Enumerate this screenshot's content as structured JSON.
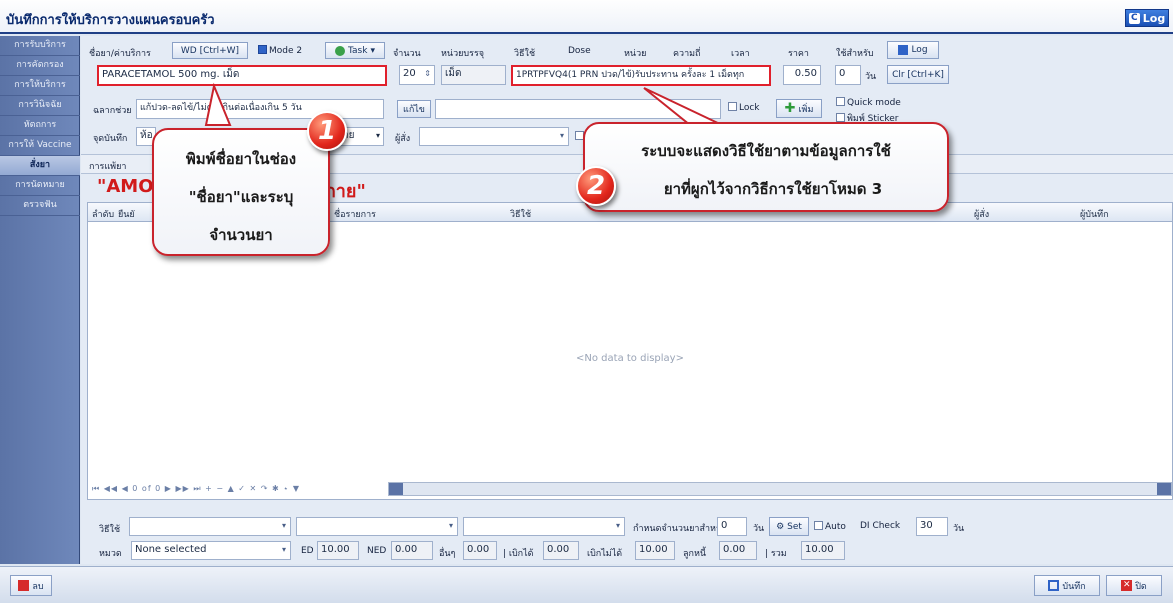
{
  "window": {
    "title": "บันทึกการให้บริการวางแผนครอบครัว",
    "log_label": "Log"
  },
  "sidebar": {
    "items": [
      {
        "label": "การรับบริการ"
      },
      {
        "label": "การคัดกรอง"
      },
      {
        "label": "การให้บริการ"
      },
      {
        "label": "การวินิจฉัย"
      },
      {
        "label": "หัตถการ"
      },
      {
        "label": "การให้ Vaccine"
      },
      {
        "label": "สั่งยา",
        "active": true
      },
      {
        "label": "การนัดหมาย"
      },
      {
        "label": "ตรวจฟัน"
      }
    ]
  },
  "header_row": {
    "drug_label": "ชื่อยา/ค่าบริการ",
    "wd_button": "WD [Ctrl+W]",
    "mode2_label": "Mode 2",
    "task_button": "Task",
    "qty_label": "จำนวน",
    "unit_label": "หน่วยบรรจุ",
    "usage_label": "วิธีใช้",
    "dose_label": "Dose",
    "dose_unit_label": "หน่วย",
    "freq_label": "ความถี่",
    "time_label": "เวลา",
    "price_label": "ราคา",
    "use_for_label": "ใช้สำหรับ",
    "log_button": "Log"
  },
  "entry_row": {
    "drug_name": "PARACETAMOL 500 mg. เม็ด",
    "qty": "20",
    "unit": "เม็ด",
    "usage": "1PRTPFVQ4(1 PRN ปวด/ไข้)รับประทาน ครั้งละ 1 เม็ดทุก",
    "price": "0.50",
    "days": "0",
    "days_unit": "วัน",
    "clear_button": "Clr [Ctrl+K]"
  },
  "label_row": {
    "label_help": "ฉลากช่วย",
    "label_help_value": "แก้ปวด-ลดไข้/ไม่ควรกินต่อเนื่องเกิน 5 วัน",
    "edit_button": "แก้ไข",
    "lock_label": "Lock",
    "add_button": "เพิ่ม",
    "quick_mode_label": "Quick mode",
    "print_sticker_label": "พิมพ์ Sticker"
  },
  "point_row": {
    "point_label": "จุดบันทึก",
    "point_value": "ห้อ",
    "by_label": "าย",
    "orderer_label": "ผู้สั่ง"
  },
  "section": {
    "tab_label": "การแพ้ยา",
    "banner_left": "\"AMOX",
    "banner_right": "างกาย\""
  },
  "grid": {
    "columns": [
      "ลำดับ",
      "ยืนยั",
      "ชื่อรายการ",
      "วิธีใช้",
      "ผู้สั่ง",
      "ผู้บันทึก"
    ],
    "empty_text": "<No data to display>",
    "nav_text": "⏮ ◀◀ ◀ 0 of 0 ▶ ▶▶ ⏭ + − ▲ ✓ ✕ ↷ ✱ ⋆ ▼"
  },
  "bottom": {
    "usage_label": "วิธีใช้",
    "calc_days_label": "กำหนดจำนวนยาสำหรับ",
    "calc_days_value": "0",
    "calc_days_unit": "วัน",
    "set_button": "Set",
    "auto_label": "Auto",
    "di_check_label": "DI Check",
    "di_check_value": "30",
    "di_unit": "วัน",
    "category_label": "หมวด",
    "category_value": "None selected",
    "ed_label": "ED",
    "ed_value": "10.00",
    "ned_label": "NED",
    "ned_value": "0.00",
    "other_label": "อื่นๆ",
    "other_value": "0.00",
    "reimb_label": "| เบิกได้",
    "reimb_value": "0.00",
    "nonreimb_label": "เบิกไม่ได้",
    "nonreimb_value": "10.00",
    "debt_label": "ลูกหนี้",
    "debt_value": "0.00",
    "total_label": "| รวม",
    "total_value": "10.00"
  },
  "footer": {
    "delete_button": "ลบ",
    "save_button": "บันทึก",
    "close_button": "ปิด"
  },
  "callouts": {
    "one_number": "1",
    "one_lines": [
      "พิมพ์ชื่อยาในช่อง",
      "\"ชื่อยา\"และระบุ",
      "จำนวนยา"
    ],
    "two_number": "2",
    "two_lines": [
      "ระบบจะแสดงวิธีใช้ยาตามข้อมูลการใช้",
      "ยาที่ผูกไว้จากวิธีการใช้ยาโหมด 3"
    ]
  }
}
